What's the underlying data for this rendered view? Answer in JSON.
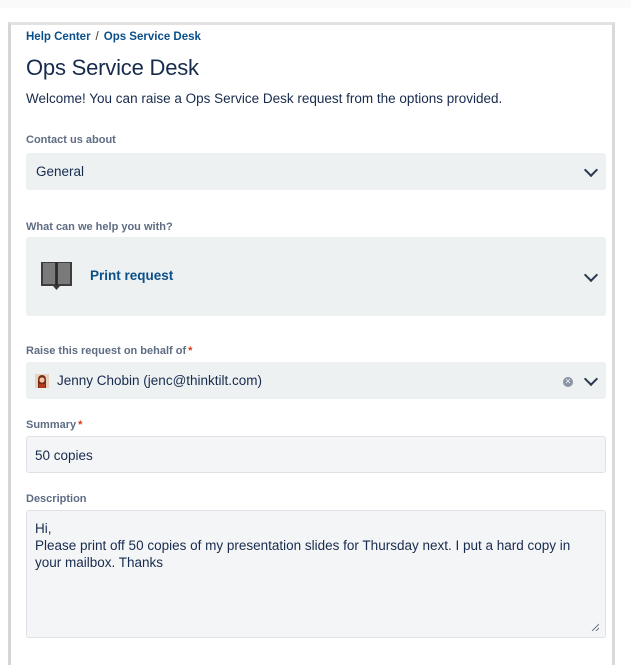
{
  "breadcrumb": {
    "home": "Help Center",
    "separator": "/",
    "current": "Ops Service Desk"
  },
  "page": {
    "title": "Ops Service Desk",
    "welcome": "Welcome! You can raise a Ops Service Desk request from the options provided."
  },
  "contact": {
    "label": "Contact us about",
    "value": "General"
  },
  "help": {
    "label": "What can we help you with?",
    "value": "Print request",
    "icon": "book-icon"
  },
  "behalf": {
    "label": "Raise this request on behalf of",
    "required_mark": "*",
    "value": "Jenny Chobin (jenc@thinktilt.com)"
  },
  "summary": {
    "label": "Summary",
    "required_mark": "*",
    "value": "50 copies"
  },
  "description": {
    "label": "Description",
    "value": "Hi,\nPlease print off 50 copies of my presentation slides for Thursday next. I put a hard copy in your mailbox. Thanks"
  },
  "colors": {
    "link": "#0b4f8a",
    "text": "#172b4d",
    "field_bg": "#edf1f2",
    "required": "#de350b"
  }
}
